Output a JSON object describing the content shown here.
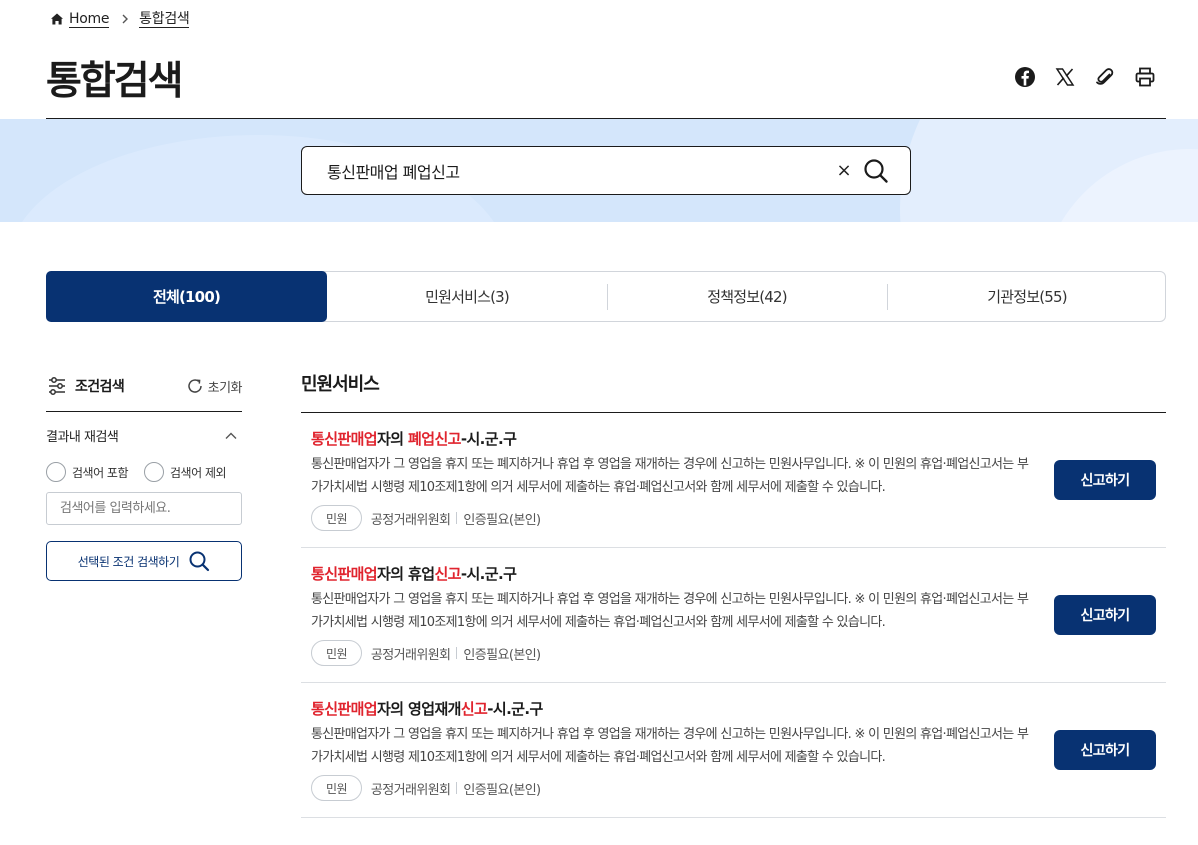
{
  "breadcrumb": {
    "home": "Home",
    "current": "통합검색"
  },
  "page": {
    "title": "통합검색"
  },
  "share": {
    "icons": [
      "facebook-icon",
      "x-twitter-icon",
      "paperclip-icon",
      "print-icon"
    ]
  },
  "search": {
    "query": "통신판매업 폐업신고",
    "clear_symbol": "×"
  },
  "tabs": [
    {
      "label": "전체(100)",
      "active": true
    },
    {
      "label": "민원서비스(3)",
      "active": false
    },
    {
      "label": "정책정보(42)",
      "active": false
    },
    {
      "label": "기관정보(55)",
      "active": false
    }
  ],
  "sidebar": {
    "title": "조건검색",
    "reset_label": "초기화",
    "refine_label": "결과내 재검색",
    "include_label": "검색어 포함",
    "exclude_label": "검색어 제외",
    "input_placeholder": "검색어를 입력하세요.",
    "submit_label": "선택된 조건 검색하기"
  },
  "results": {
    "section_title": "민원서비스",
    "items": [
      {
        "title_hl1": "통신판매업",
        "title_mid": "자의 ",
        "title_hl2": "폐업신고",
        "title_end": "-시.군.구",
        "description": "통신판매업자가 그 영업을 휴지 또는 폐지하거나 휴업 후 영업을 재개하는 경우에 신고하는 민원사무입니다. ※ 이 민원의 휴업·폐업신고서는 부가가치세법 시행령 제10조제1항에 의거 세무서에 제출하는 휴업·폐업신고서와 함께 세무서에 제출할 수 있습니다.",
        "badge": "민원",
        "agency": "공정거래위원회",
        "auth": "인증필요(본인)",
        "button": "신고하기"
      },
      {
        "title_hl1": "통신판매업",
        "title_mid": "자의 휴업",
        "title_hl2": "신고",
        "title_end": "-시.군.구",
        "description": "통신판매업자가 그 영업을 휴지 또는 폐지하거나 휴업 후 영업을 재개하는 경우에 신고하는 민원사무입니다. ※ 이 민원의 휴업·폐업신고서는 부가가치세법 시행령 제10조제1항에 의거 세무서에 제출하는 휴업·폐업신고서와 함께 세무서에 제출할 수 있습니다.",
        "badge": "민원",
        "agency": "공정거래위원회",
        "auth": "인증필요(본인)",
        "button": "신고하기"
      },
      {
        "title_hl1": "통신판매업",
        "title_mid": "자의 영업재개",
        "title_hl2": "신고",
        "title_end": "-시.군.구",
        "description": "통신판매업자가 그 영업을 휴지 또는 폐지하거나 휴업 후 영업을 재개하는 경우에 신고하는 민원사무입니다. ※ 이 민원의 휴업·폐업신고서는 부가가치세법 시행령 제10조제1항에 의거 세무서에 제출하는 휴업·폐업신고서와 함께 세무서에 제출할 수 있습니다.",
        "badge": "민원",
        "agency": "공정거래위원회",
        "auth": "인증필요(본인)",
        "button": "신고하기"
      }
    ]
  },
  "colors": {
    "primary": "#083272",
    "highlight": "#e0242e",
    "band": "#d4e6fb"
  }
}
